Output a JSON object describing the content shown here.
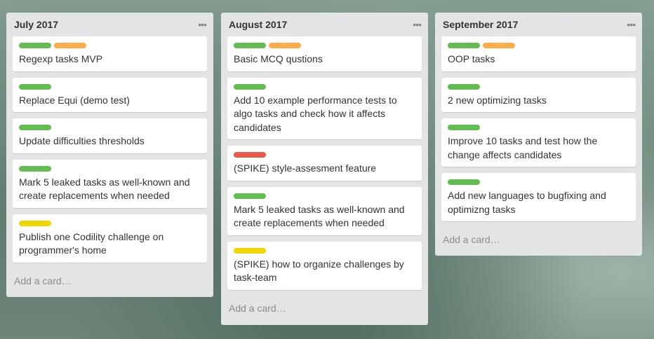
{
  "label_colors": {
    "green": "#61bd4f",
    "orange": "#ffab4a",
    "red": "#eb5a46",
    "yellow": "#f2d600"
  },
  "lists": [
    {
      "title": "July 2017",
      "menu_icon": "ellipsis-icon",
      "add_card": "Add a card…",
      "cards": [
        {
          "title": "Regexp tasks MVP",
          "labels": [
            "green",
            "orange"
          ]
        },
        {
          "title": "Replace Equi (demo test)",
          "labels": [
            "green"
          ]
        },
        {
          "title": "Update difficulties thresholds",
          "labels": [
            "green"
          ]
        },
        {
          "title": "Mark 5 leaked tasks as well-known and create replacements when needed",
          "labels": [
            "green"
          ]
        },
        {
          "title": "Publish one Codility challenge on programmer's home",
          "labels": [
            "yellow"
          ]
        }
      ]
    },
    {
      "title": "August 2017",
      "menu_icon": "ellipsis-icon",
      "add_card": "Add a card…",
      "cards": [
        {
          "title": "Basic MCQ qustions",
          "labels": [
            "green",
            "orange"
          ]
        },
        {
          "title": "Add 10 example performance tests to algo tasks and check how it affects candidates",
          "labels": [
            "green"
          ]
        },
        {
          "title": "(SPIKE) style-assesment feature",
          "labels": [
            "red"
          ]
        },
        {
          "title": "Mark 5 leaked tasks as well-known and create replacements when needed",
          "labels": [
            "green"
          ]
        },
        {
          "title": "(SPIKE) how to organize challenges by task-team",
          "labels": [
            "yellow"
          ]
        }
      ]
    },
    {
      "title": "September 2017",
      "menu_icon": "ellipsis-icon",
      "add_card": "Add a card…",
      "cards": [
        {
          "title": "OOP tasks",
          "labels": [
            "green",
            "orange"
          ]
        },
        {
          "title": "2 new optimizing tasks",
          "labels": [
            "green"
          ]
        },
        {
          "title": "Improve 10 tasks and test how the change affects candidates",
          "labels": [
            "green"
          ]
        },
        {
          "title": "Add new languages to bugfixing and optimizng tasks",
          "labels": [
            "green"
          ]
        }
      ]
    }
  ]
}
